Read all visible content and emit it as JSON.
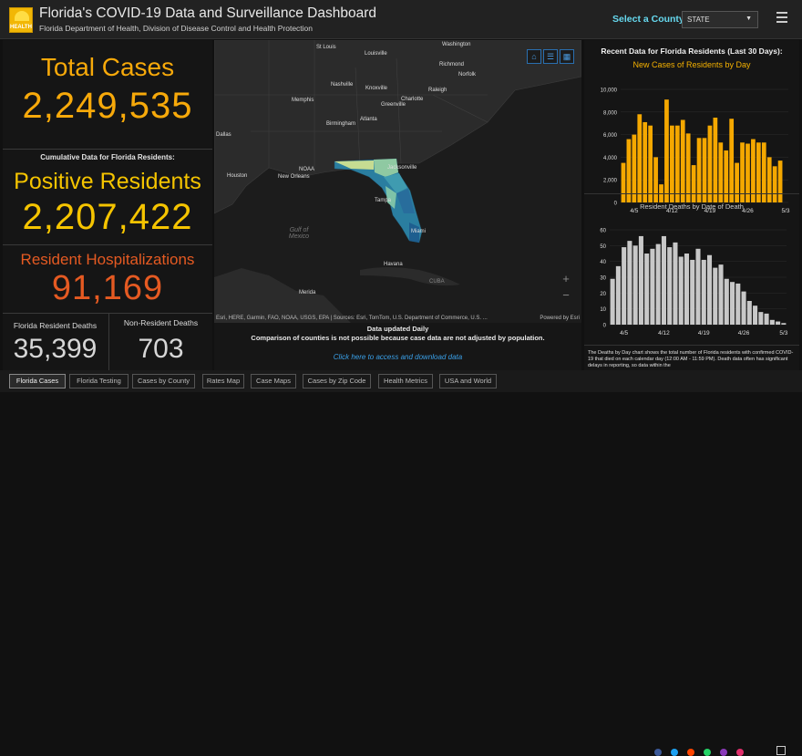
{
  "header": {
    "title": "Florida's COVID-19 Data and Surveillance Dashboard",
    "subtitle": "Florida Department of Health, Division of Disease Control and Health Protection",
    "logo_text": "HEALTH",
    "select_label": "Select a County",
    "select_value": "STATE"
  },
  "left": {
    "total_label": "Total Cases",
    "total_value": "2,249,535",
    "cumulative_label": "Cumulative Data for Florida Residents:",
    "positive_label": "Positive Residents",
    "positive_value": "2,207,422",
    "hosp_label": "Resident Hospitalizations",
    "hosp_value": "91,169",
    "deaths_label": "Florida Resident Deaths",
    "deaths_value": "35,399",
    "nonres_label": "Non-Resident Deaths",
    "nonres_value": "703"
  },
  "map": {
    "labels": [
      "St Louis",
      "Louisville",
      "Washington",
      "Richmond",
      "Norfolk",
      "Nashville",
      "Knoxville",
      "Raleigh",
      "Memphis",
      "Charlotte",
      "Greenville",
      "Birmingham",
      "Atlanta",
      "Dallas",
      "Houston",
      "New Orleans",
      "NOAA",
      "Jacksonville",
      "Tampa",
      "Miami",
      "Havana",
      "Merida",
      "CUBA",
      "Gulf of Mexico"
    ],
    "tools": [
      "home-icon",
      "list-icon",
      "grid-icon"
    ],
    "zoom_in": "+",
    "zoom_out": "−",
    "attribution": "Esri, HERE, Garmin, FAO, NOAA, USGS, EPA | Sources: Esri, TomTom, U.S. Department of Commerce, U.S. ...",
    "powered_by": "Powered by Esri",
    "update_line1": "Data updated Daily",
    "update_line2": "Comparison of counties is not possible because case data are not adjusted by population.",
    "link_text": "Click here to access and download data"
  },
  "right": {
    "title": "Recent Data for Florida Residents (Last 30 Days):",
    "cases_title": "New Cases of Residents by Day",
    "deaths_title": "Resident Deaths by Date of Death",
    "note": "The Deaths by Day chart shows the total number of Florida residents with confirmed COVID-19 that died on each calendar day (12:00 AM - 11:59 PM). Death data often has significant delays in reporting, so data within the"
  },
  "chart_data": [
    {
      "type": "bar",
      "title": "New Cases of Residents by Day",
      "categories": [
        "4/3",
        "4/4",
        "4/5",
        "4/6",
        "4/7",
        "4/8",
        "4/9",
        "4/10",
        "4/11",
        "4/12",
        "4/13",
        "4/14",
        "4/15",
        "4/16",
        "4/17",
        "4/18",
        "4/19",
        "4/20",
        "4/21",
        "4/22",
        "4/23",
        "4/24",
        "4/25",
        "4/26",
        "4/27",
        "4/28",
        "4/29",
        "4/30",
        "5/1",
        "5/2",
        "5/3"
      ],
      "x_ticks": [
        "4/5",
        "4/12",
        "4/19",
        "4/26",
        "5/3"
      ],
      "values": [
        3500,
        5600,
        6000,
        7800,
        7100,
        6800,
        4000,
        1600,
        9100,
        6800,
        6800,
        7300,
        6100,
        3300,
        5700,
        5700,
        6800,
        7500,
        5300,
        4600,
        7400,
        3500,
        5300,
        5200,
        5600,
        5300,
        5300,
        4000,
        3200,
        3700,
        0
      ],
      "ylim": [
        0,
        10000
      ],
      "yticks": [
        "10,000",
        "8,000",
        "6,000",
        "4,000",
        "2,000",
        "0"
      ],
      "color": "#f5a800"
    },
    {
      "type": "bar",
      "title": "Resident Deaths by Date of Death",
      "categories": [
        "4/3",
        "4/4",
        "4/5",
        "4/6",
        "4/7",
        "4/8",
        "4/9",
        "4/10",
        "4/11",
        "4/12",
        "4/13",
        "4/14",
        "4/15",
        "4/16",
        "4/17",
        "4/18",
        "4/19",
        "4/20",
        "4/21",
        "4/22",
        "4/23",
        "4/24",
        "4/25",
        "4/26",
        "4/27",
        "4/28",
        "4/29",
        "4/30",
        "5/1",
        "5/2",
        "5/3"
      ],
      "x_ticks": [
        "4/5",
        "4/12",
        "4/19",
        "4/26",
        "5/3"
      ],
      "values": [
        29,
        37,
        49,
        53,
        50,
        56,
        45,
        48,
        51,
        56,
        49,
        52,
        43,
        45,
        41,
        48,
        41,
        44,
        36,
        38,
        29,
        27,
        26,
        21,
        15,
        12,
        8,
        7,
        3,
        2,
        1
      ],
      "ylim": [
        0,
        60
      ],
      "yticks": [
        "60",
        "50",
        "40",
        "30",
        "20",
        "10",
        "0"
      ],
      "color": "#c8c8c8"
    }
  ],
  "tabs": [
    "Florida Cases",
    "Florida Testing",
    "Cases by County",
    "Rates Map",
    "Case Maps",
    "Cases by Zip Code",
    "Health Metrics",
    "USA and World"
  ],
  "social_icons": [
    "facebook-icon",
    "twitter-icon",
    "reddit-icon",
    "whatsapp-icon",
    "instagram-icon",
    "email-icon"
  ]
}
